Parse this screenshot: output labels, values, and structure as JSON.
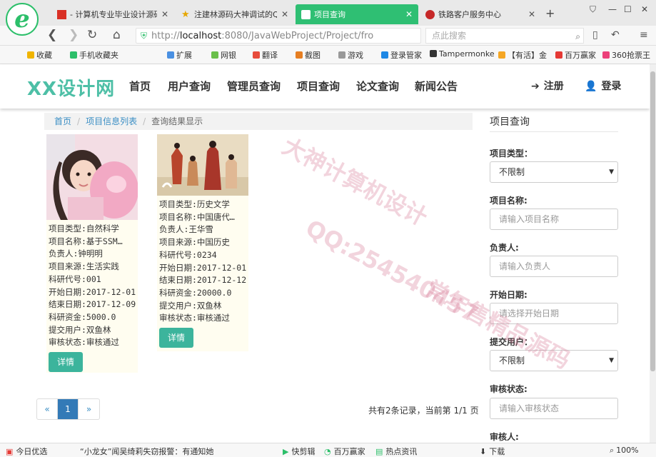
{
  "browser": {
    "tabs": [
      {
        "title": "- 计算机专业毕业设计源码",
        "active": false
      },
      {
        "title": "注建林源码大神调试的QQ",
        "active": false
      },
      {
        "title": "项目查询",
        "active": true
      },
      {
        "title": "铁路客户服务中心",
        "active": false
      }
    ],
    "url_scheme": "http://",
    "url_host": "localhost",
    "url_rest": ":8080/JavaWebProject/Project/fro",
    "search_placeholder": "点此搜索",
    "bookmarks": [
      "收藏",
      "手机收藏夹",
      "扩展",
      "网银",
      "翻译",
      "截图",
      "游戏",
      "登录管家",
      "Tampermonke",
      "【有活】金",
      "百万赢家",
      "360抢票王"
    ]
  },
  "site": {
    "logo": "XX设计网",
    "nav": [
      "首页",
      "用户查询",
      "管理员查询",
      "项目查询",
      "论文查询",
      "新闻公告"
    ],
    "register": "注册",
    "login": "登录"
  },
  "breadcrumb": {
    "home": "首页",
    "list": "项目信息列表",
    "current": "查询结果显示"
  },
  "cards": [
    {
      "type": "项目类型:自然科学",
      "name": "项目名称:基于SSM…",
      "leader": "负责人:钟明明",
      "source": "项目来源:生活实践",
      "code": "科研代号:001",
      "start": "开始日期:2017-12-01",
      "end": "结束日期:2017-12-09",
      "fund": "科研资金:5000.0",
      "user": "提交用户:双鱼林",
      "status": "审核状态:审核通过",
      "button": "详情"
    },
    {
      "type": "项目类型:历史文学",
      "name": "项目名称:中国唐代…",
      "leader": "负责人:王华雪",
      "source": "项目来源:中国历史",
      "code": "科研代号:0234",
      "start": "开始日期:2017-12-01",
      "end": "结束日期:2017-12-12",
      "fund": "科研资金:20000.0",
      "user": "提交用户:双鱼林",
      "status": "审核状态:审核通过",
      "button": "详情"
    }
  ],
  "pagination": {
    "prev": "«",
    "current": "1",
    "next": "»",
    "info": "共有2条记录，当前第 1/1 页"
  },
  "sidebar": {
    "title": "项目查询",
    "type_label": "项目类型：",
    "type_value": "不限制",
    "name_label": "项目名称:",
    "name_placeholder": "请输入项目名称",
    "leader_label": "负责人:",
    "leader_placeholder": "请输入负责人",
    "start_label": "开始日期:",
    "start_placeholder": "请选择开始日期",
    "user_label": "提交用户：",
    "user_value": "不限制",
    "status_label": "审核状态:",
    "status_placeholder": "请输入审核状态",
    "reviewer_label": "审核人:"
  },
  "statusbar": {
    "left": "今日优选",
    "news": "“小龙女”闻吴绮莉失窃报警：有通知她",
    "items": [
      "快剪辑",
      "百万赢家",
      "热点资讯",
      "下载"
    ],
    "zoom": "100%"
  },
  "watermarks": [
    "QQ:254540457",
    "大神计算机设计",
    "常年售精品源码"
  ]
}
